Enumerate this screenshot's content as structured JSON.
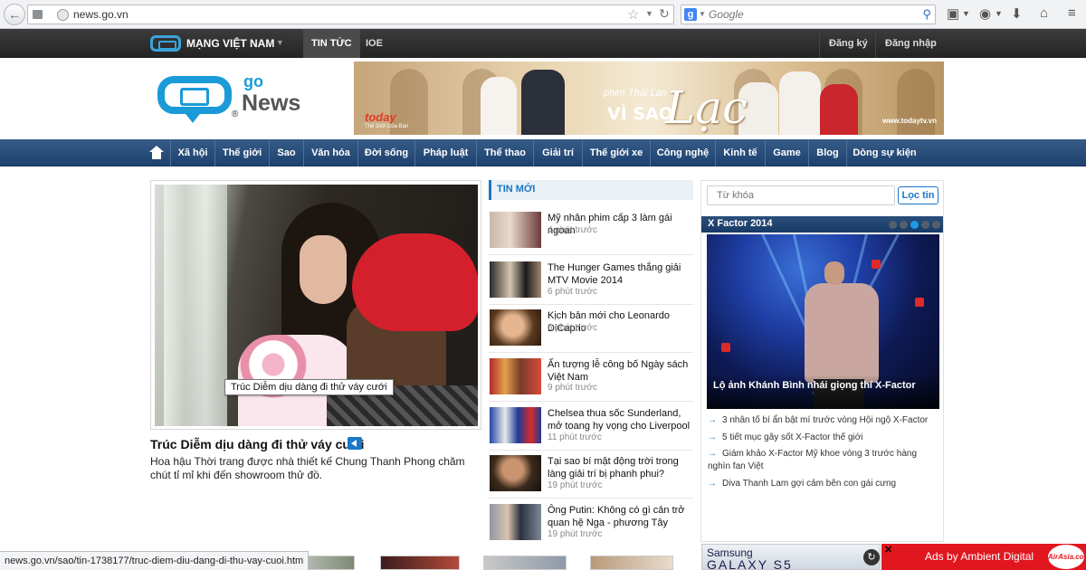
{
  "browser": {
    "url": "news.go.vn",
    "search_placeholder": "Google",
    "search_engine": "g",
    "status_url": "news.go.vn/sao/tin-1738177/truc-diem-diu-dang-di-thu-vay-cuoi.htm"
  },
  "portal": {
    "brand": "MẠNG VIỆT NAM",
    "tabs": [
      "TIN TỨC",
      "IOE"
    ],
    "active_tab": "TIN TỨC",
    "register": "Đăng ký",
    "login": "Đăng nhập"
  },
  "logo": {
    "go": "go",
    "news": "News",
    "reg": "®"
  },
  "banner": {
    "brand": "today",
    "brand_sub": "Thế Giới Của Bạn",
    "phim": "phim Thái Lan",
    "title_a": "VÌ SAO",
    "title_b": "Lạc",
    "url": "www.todaytv.vn"
  },
  "nav": {
    "items": [
      "Xã hội",
      "Thế giới",
      "Sao",
      "Văn hóa",
      "Đời sống",
      "Pháp luật",
      "Thể thao",
      "Giải trí",
      "Thế giới xe",
      "Công nghệ",
      "Kinh tế",
      "Game",
      "Blog",
      "Dòng sự kiện"
    ]
  },
  "hero": {
    "tooltip": "Trúc Diễm dịu dàng đi thử váy cưới",
    "title": "Trúc Diễm dịu dàng đi thử váy cưới",
    "desc": "Hoa hậu Thời trang được nhà thiết kế Chung Thanh Phong chăm chút tỉ mỉ khi đến showroom thử đồ."
  },
  "tin_moi": {
    "header": "TIN MỚI",
    "items": [
      {
        "title": "Mỹ nhân phim cấp 3 làm gái ngoan",
        "time": "4 phút trước"
      },
      {
        "title": "The Hunger Games thắng giải MTV Movie 2014",
        "time": "6 phút trước"
      },
      {
        "title": "Kịch bản mới cho Leonardo DiCaprio",
        "time": "6 phút trước"
      },
      {
        "title": "Ấn tượng lễ công bố Ngày sách Việt Nam",
        "time": "9 phút trước"
      },
      {
        "title": "Chelsea thua sốc Sunderland, mở toang hy vọng cho Liverpool",
        "time": "11 phút trước"
      },
      {
        "title": "Tại sao bí mật động trời trong làng giải trí bị phanh phui?",
        "time": "19 phút trước"
      },
      {
        "title": "Ông Putin: Không có gì cản trở quan hệ Nga - phương Tây",
        "time": "19 phút trước"
      }
    ]
  },
  "sidebar": {
    "keyword_placeholder": "Từ khóa",
    "search_button": "Lọc tin",
    "xfactor_title": "X Factor 2014",
    "active_dot": 3,
    "photo_caption": "Lộ ảnh Khánh Bình nhái giọng thí X-Factor",
    "links": [
      "3 nhân tố bí ẩn bật mí trước vòng Hội ngộ X-Factor",
      "5 tiết mục gây sốt X-Factor thế giới",
      "Giám khảo X-Factor Mỹ khoe vòng 3 trước hàng nghìn fan Việt",
      "Diva Thanh Lam gợi cảm bên con gái cưng"
    ]
  },
  "ads": {
    "samsung_brand": "Samsung",
    "samsung_model": "GALAXY S5",
    "airasia_label": "Ads by Ambient Digital",
    "airasia_logo": "AirAsia.com",
    "close": "✕"
  }
}
